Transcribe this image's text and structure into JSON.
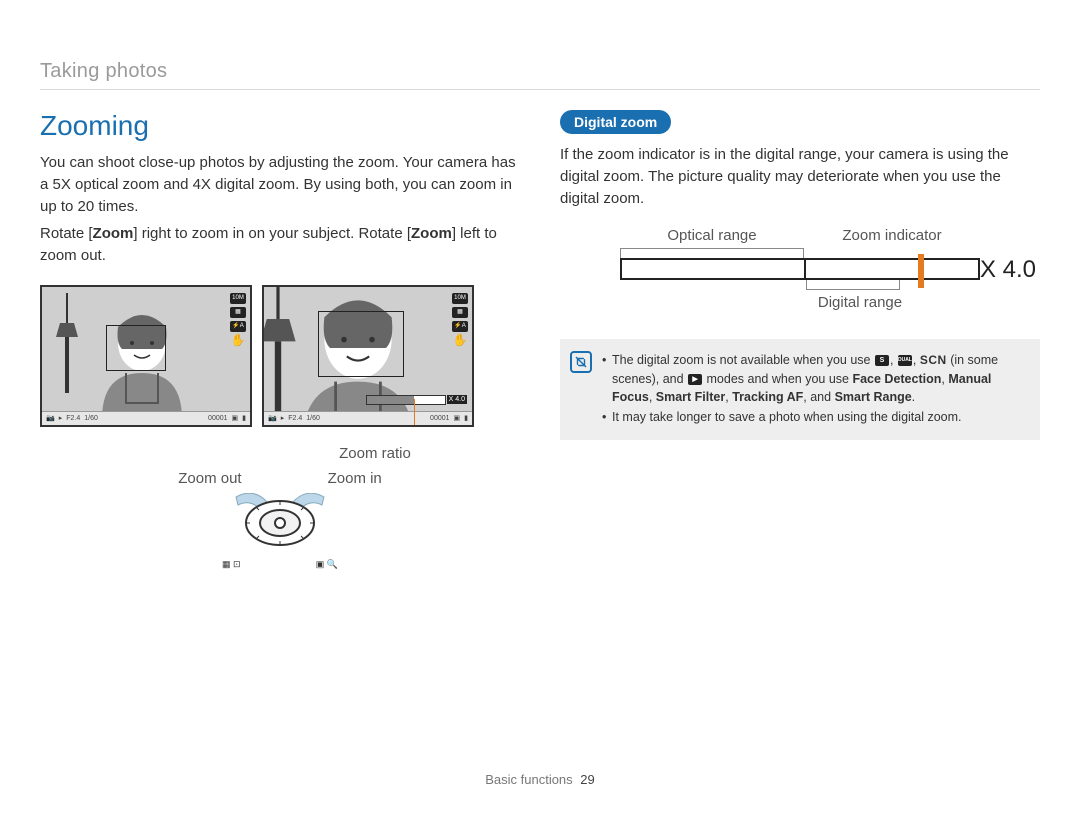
{
  "breadcrumb": "Taking photos",
  "title": "Zooming",
  "para1": "You can shoot close-up photos by adjusting the zoom. Your camera has a 5X optical zoom and 4X digital zoom. By using both, you can zoom in up to 20 times.",
  "para2_pre": "Rotate [",
  "para2_zoom": "Zoom",
  "para2_mid": "] right to zoom in on your subject. Rotate [",
  "para2_post": "] left to zoom out.",
  "screen_bottom": {
    "aperture": "F2.4",
    "shutter": "1/60",
    "count": "00001"
  },
  "zoom_bar_label": "X 4.0",
  "labels": {
    "zoom_ratio": "Zoom ratio",
    "zoom_out": "Zoom out",
    "zoom_in": "Zoom in"
  },
  "digital": {
    "pill": "Digital zoom",
    "para": "If the zoom indicator is in the digital range, your camera is using the digital zoom. The picture quality may deteriorate when you use the digital zoom.",
    "optical_range": "Optical range",
    "zoom_indicator": "Zoom indicator",
    "digital_range": "Digital range",
    "x40": "X 4.0"
  },
  "notes": {
    "n1_pre": "The digital zoom is not available when you use ",
    "n1_mid": " (in some scenes), and ",
    "n1_post": " modes and when you use ",
    "n1_features": "Face Detection",
    "n1_sep": ", ",
    "n1_f2": "Manual Focus",
    "n1_f3": "Smart Filter",
    "n1_f4": "Tracking AF",
    "n1_and": ", and ",
    "n1_f5": "Smart Range",
    "n1_dot": ".",
    "scn": "SCN",
    "dual": "DUAL",
    "n2": "It may take longer to save a photo when using the digital zoom."
  },
  "footer": {
    "section": "Basic functions",
    "page": "29"
  }
}
